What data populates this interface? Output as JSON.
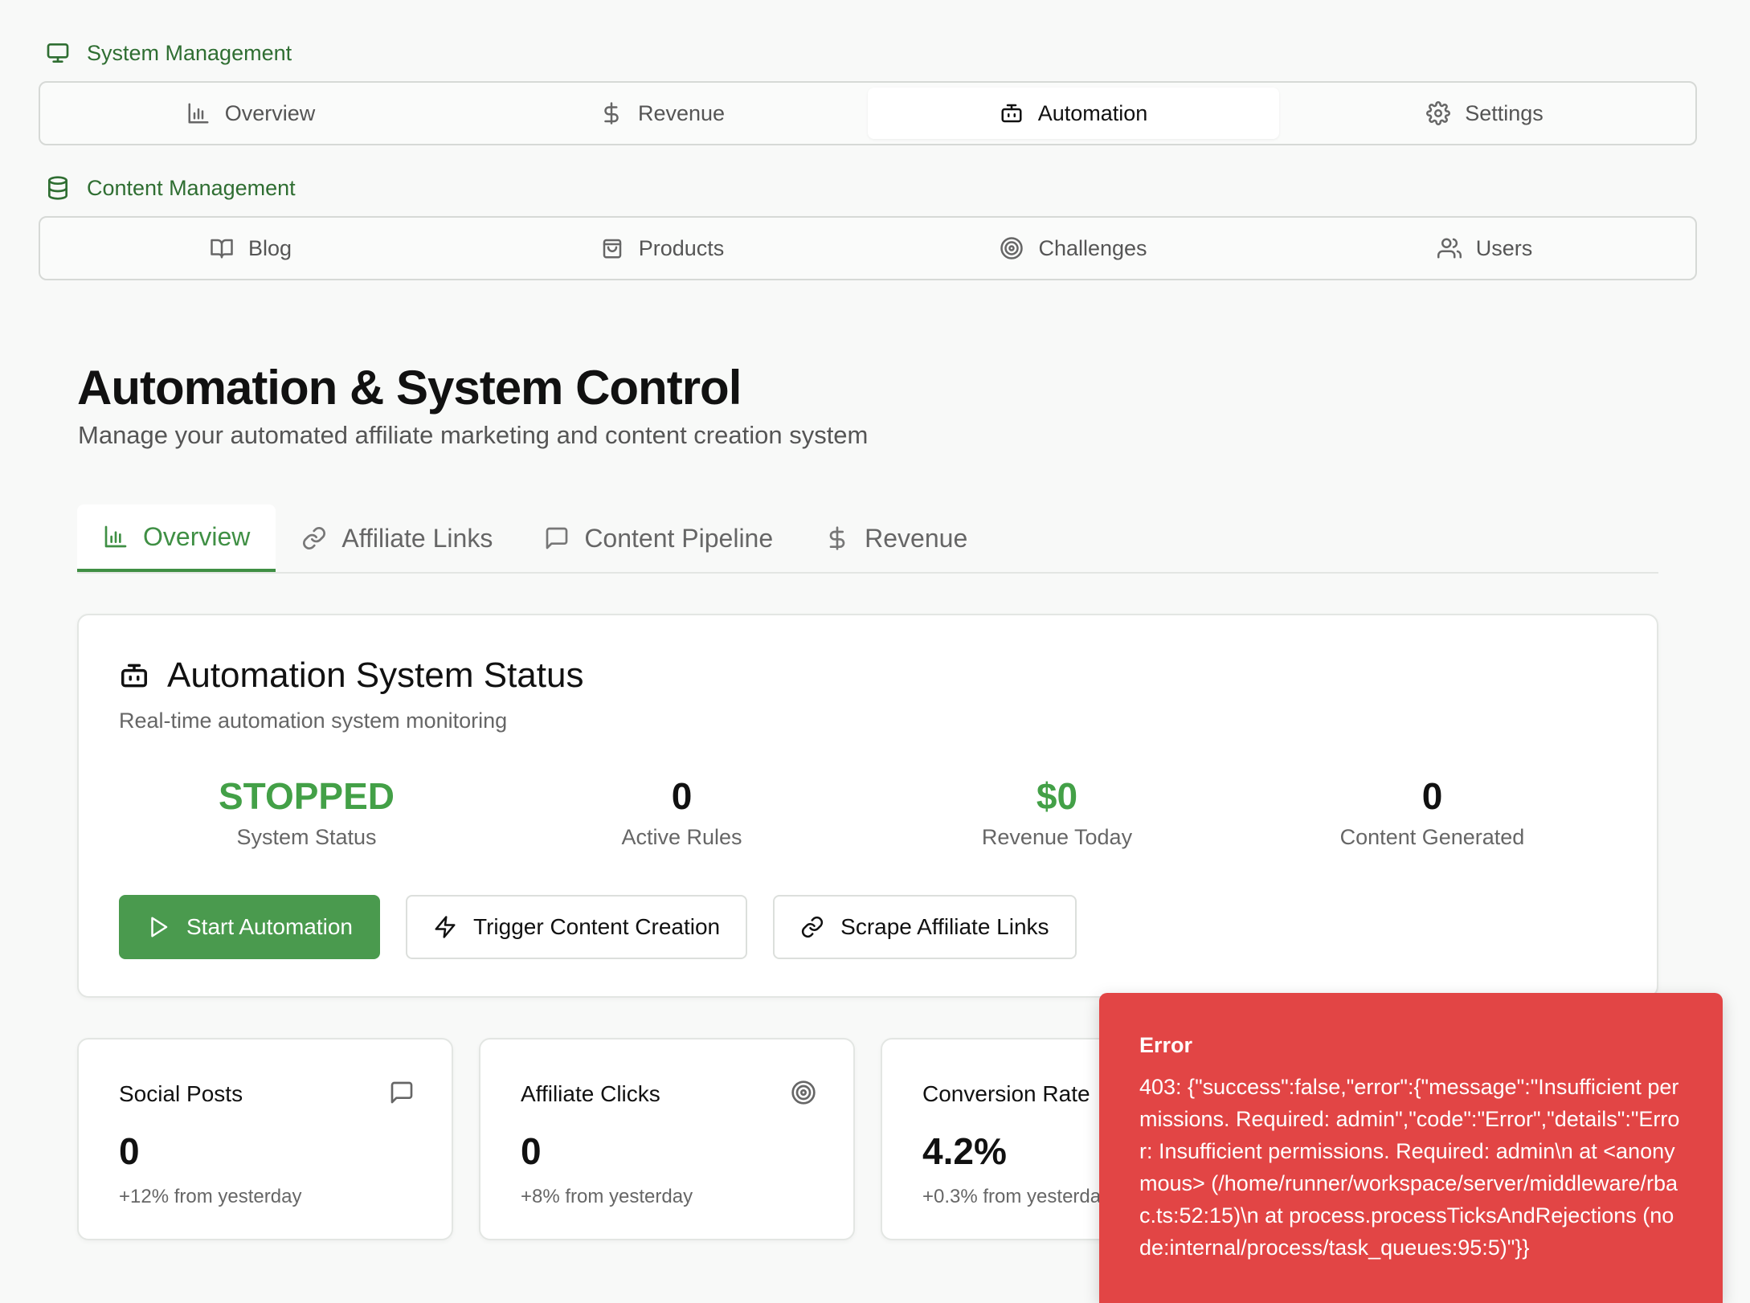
{
  "system_nav": {
    "label": "System Management",
    "items": [
      {
        "label": "Overview",
        "icon": "bar-chart-icon"
      },
      {
        "label": "Revenue",
        "icon": "dollar-icon"
      },
      {
        "label": "Automation",
        "icon": "bot-icon",
        "active": true
      },
      {
        "label": "Settings",
        "icon": "gear-icon"
      }
    ]
  },
  "content_nav": {
    "label": "Content Management",
    "items": [
      {
        "label": "Blog",
        "icon": "book-icon"
      },
      {
        "label": "Products",
        "icon": "shopping-bag-icon"
      },
      {
        "label": "Challenges",
        "icon": "target-icon"
      },
      {
        "label": "Users",
        "icon": "users-icon"
      }
    ]
  },
  "page": {
    "title": "Automation & System Control",
    "subtitle": "Manage your automated affiliate marketing and content creation system"
  },
  "tabs": [
    {
      "label": "Overview",
      "icon": "bar-chart-icon",
      "active": true
    },
    {
      "label": "Affiliate Links",
      "icon": "link-icon"
    },
    {
      "label": "Content Pipeline",
      "icon": "message-square-icon"
    },
    {
      "label": "Revenue",
      "icon": "dollar-icon"
    }
  ],
  "status_card": {
    "title": "Automation System Status",
    "description": "Real-time automation system monitoring",
    "stats": [
      {
        "value": "STOPPED",
        "label": "System Status"
      },
      {
        "value": "0",
        "label": "Active Rules"
      },
      {
        "value": "$0",
        "label": "Revenue Today"
      },
      {
        "value": "0",
        "label": "Content Generated"
      }
    ],
    "actions": {
      "start": "Start Automation",
      "trigger": "Trigger Content Creation",
      "scrape": "Scrape Affiliate Links"
    }
  },
  "metrics": [
    {
      "title": "Social Posts",
      "value": "0",
      "change": "+12% from yesterday",
      "icon": "message-square-icon"
    },
    {
      "title": "Affiliate Clicks",
      "value": "0",
      "change": "+8% from yesterday",
      "icon": "target-icon"
    },
    {
      "title": "Conversion Rate",
      "value": "4.2%",
      "change": "+0.3% from yesterday"
    }
  ],
  "toast": {
    "title": "Error",
    "message": "403: {\"success\":false,\"error\":{\"message\":\"Insufficient permissions. Required: admin\",\"code\":\"Error\",\"details\":\"Error: Insufficient permissions. Required: admin\\n at <anonymous> (/home/runner/workspace/server/middleware/rbac.ts:52:15)\\n at process.processTicksAndRejections (node:internal/process/task_queues:95:5)\"}}"
  },
  "colors": {
    "accent": "#3f8f44",
    "primary_button": "#4a9a4e",
    "status_green": "#43a047",
    "error": "#e24545"
  }
}
